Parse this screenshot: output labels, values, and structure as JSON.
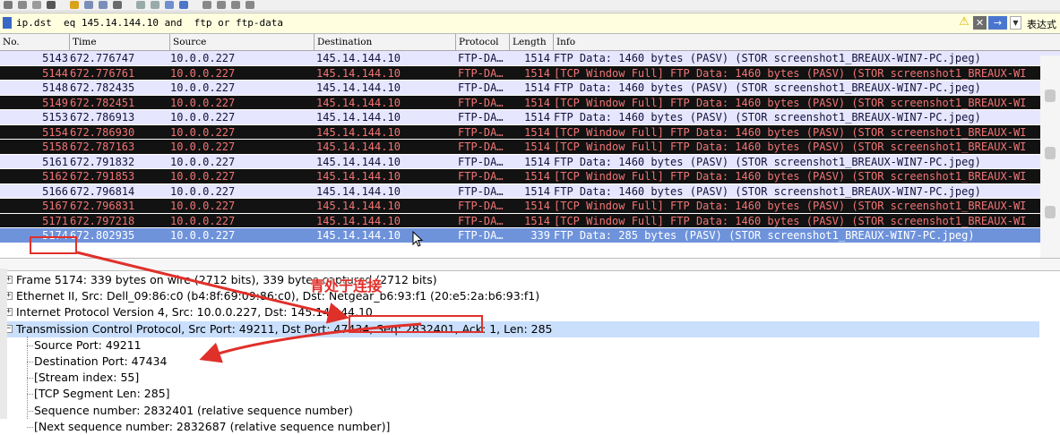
{
  "filter": {
    "value": "ip.dst  eq 145.14.144.10 and  ftp or ftp-data",
    "expression_label": "表达式"
  },
  "columns": [
    "No.",
    "Time",
    "Source",
    "Destination",
    "Protocol",
    "Length",
    "Info"
  ],
  "packets": [
    {
      "no": "5143",
      "time": "672.776747",
      "src": "10.0.0.227",
      "dst": "145.14.144.10",
      "proto": "FTP-DA…",
      "len": "1514",
      "info": "FTP Data: 1460 bytes (PASV) (STOR screenshot1_BREAUX-WIN7-PC.jpeg)",
      "style": "normal"
    },
    {
      "no": "5144",
      "time": "672.776761",
      "src": "10.0.0.227",
      "dst": "145.14.144.10",
      "proto": "FTP-DA…",
      "len": "1514",
      "info": "[TCP Window Full] FTP Data: 1460 bytes (PASV) (STOR screenshot1_BREAUX-WI",
      "style": "dark"
    },
    {
      "no": "5148",
      "time": "672.782435",
      "src": "10.0.0.227",
      "dst": "145.14.144.10",
      "proto": "FTP-DA…",
      "len": "1514",
      "info": "FTP Data: 1460 bytes (PASV) (STOR screenshot1_BREAUX-WIN7-PC.jpeg)",
      "style": "normal"
    },
    {
      "no": "5149",
      "time": "672.782451",
      "src": "10.0.0.227",
      "dst": "145.14.144.10",
      "proto": "FTP-DA…",
      "len": "1514",
      "info": "[TCP Window Full] FTP Data: 1460 bytes (PASV) (STOR screenshot1_BREAUX-WI",
      "style": "dark"
    },
    {
      "no": "5153",
      "time": "672.786913",
      "src": "10.0.0.227",
      "dst": "145.14.144.10",
      "proto": "FTP-DA…",
      "len": "1514",
      "info": "FTP Data: 1460 bytes (PASV) (STOR screenshot1_BREAUX-WIN7-PC.jpeg)",
      "style": "normal"
    },
    {
      "no": "5154",
      "time": "672.786930",
      "src": "10.0.0.227",
      "dst": "145.14.144.10",
      "proto": "FTP-DA…",
      "len": "1514",
      "info": "[TCP Window Full] FTP Data: 1460 bytes (PASV) (STOR screenshot1_BREAUX-WI",
      "style": "dark"
    },
    {
      "no": "5158",
      "time": "672.787163",
      "src": "10.0.0.227",
      "dst": "145.14.144.10",
      "proto": "FTP-DA…",
      "len": "1514",
      "info": "[TCP Window Full] FTP Data: 1460 bytes (PASV) (STOR screenshot1_BREAUX-WI",
      "style": "dark"
    },
    {
      "no": "5161",
      "time": "672.791832",
      "src": "10.0.0.227",
      "dst": "145.14.144.10",
      "proto": "FTP-DA…",
      "len": "1514",
      "info": "FTP Data: 1460 bytes (PASV) (STOR screenshot1_BREAUX-WIN7-PC.jpeg)",
      "style": "normal"
    },
    {
      "no": "5162",
      "time": "672.791853",
      "src": "10.0.0.227",
      "dst": "145.14.144.10",
      "proto": "FTP-DA…",
      "len": "1514",
      "info": "[TCP Window Full] FTP Data: 1460 bytes (PASV) (STOR screenshot1_BREAUX-WI",
      "style": "dark"
    },
    {
      "no": "5166",
      "time": "672.796814",
      "src": "10.0.0.227",
      "dst": "145.14.144.10",
      "proto": "FTP-DA…",
      "len": "1514",
      "info": "FTP Data: 1460 bytes (PASV) (STOR screenshot1_BREAUX-WIN7-PC.jpeg)",
      "style": "normal"
    },
    {
      "no": "5167",
      "time": "672.796831",
      "src": "10.0.0.227",
      "dst": "145.14.144.10",
      "proto": "FTP-DA…",
      "len": "1514",
      "info": "[TCP Window Full] FTP Data: 1460 bytes (PASV) (STOR screenshot1_BREAUX-WI",
      "style": "dark"
    },
    {
      "no": "5171",
      "time": "672.797218",
      "src": "10.0.0.227",
      "dst": "145.14.144.10",
      "proto": "FTP-DA…",
      "len": "1514",
      "info": "[TCP Window Full] FTP Data: 1460 bytes (PASV) (STOR screenshot1_BREAUX-WI",
      "style": "dark"
    },
    {
      "no": "5174",
      "time": "672.802935",
      "src": "10.0.0.227",
      "dst": "145.14.144.10",
      "proto": "FTP-DA…",
      "len": "339",
      "info": "FTP Data: 285 bytes (PASV) (STOR screenshot1_BREAUX-WIN7-PC.jpeg)",
      "style": "sel"
    }
  ],
  "details": [
    {
      "text": "Frame 5174: 339 bytes on wire (2712 bits), 339 bytes captured (2712 bits)",
      "expander": "+",
      "child": false,
      "selected": false
    },
    {
      "text": "Ethernet II, Src: Dell_09:86:c0 (b4:8f:69:09:86:c0), Dst: Netgear_b6:93:f1 (20:e5:2a:b6:93:f1)",
      "expander": "+",
      "child": false,
      "selected": false
    },
    {
      "text": "Internet Protocol Version 4, Src: 10.0.0.227, Dst: 145.14.144.10",
      "expander": "+",
      "child": false,
      "selected": false
    },
    {
      "text": "Transmission Control Protocol, Src Port: 49211, Dst Port: 47434, Seq: 2832401, Ack: 1, Len: 285",
      "expander": "−",
      "child": false,
      "selected": true
    },
    {
      "text": "Source Port: 49211",
      "expander": "",
      "child": true,
      "selected": false
    },
    {
      "text": "Destination Port: 47434",
      "expander": "",
      "child": true,
      "selected": false
    },
    {
      "text": "[Stream index: 55]",
      "expander": "",
      "child": true,
      "selected": false
    },
    {
      "text": "[TCP Segment Len: 285]",
      "expander": "",
      "child": true,
      "selected": false
    },
    {
      "text": "Sequence number: 2832401    (relative sequence number)",
      "expander": "",
      "child": true,
      "selected": false
    },
    {
      "text": "[Next sequence number: 2832687    (relative sequence number)]",
      "expander": "",
      "child": true,
      "selected": false
    }
  ],
  "annotation": {
    "text": "青处于连接",
    "color": "#e0302a"
  },
  "colors": {
    "normal_row_bg": "#e7e6ff",
    "dark_row_bg": "#121212",
    "dark_row_fg": "#f27474",
    "selected_row_bg": "#6e93db",
    "detail_selected_bg": "#c9dffc",
    "filter_bg": "#ffffe0"
  }
}
